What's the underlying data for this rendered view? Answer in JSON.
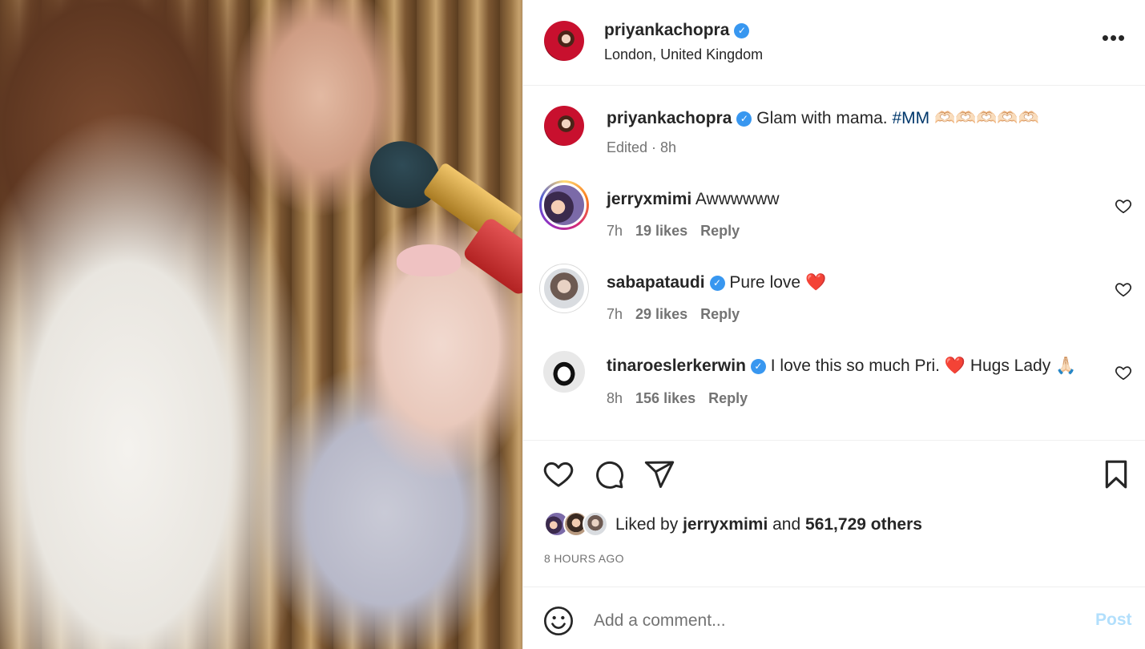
{
  "post": {
    "photo_alt": "photo-mother-baby-makeup-brush"
  },
  "header": {
    "username": "priyankachopra",
    "verified_icon": "verified-badge-icon",
    "location": "London, United Kingdom",
    "more_label": "•••"
  },
  "caption": {
    "username": "priyankachopra",
    "text": " Glam with mama. ",
    "hashtag": "#MM",
    "emoji_tail": " 🫶🏻🫶🏻🫶🏻🫶🏻🫶🏻",
    "edited": "Edited",
    "sep": " · ",
    "time": "8h"
  },
  "comments": [
    {
      "username": "jerryxmimi",
      "verified": false,
      "text": " Awwwwww",
      "time": "7h",
      "likes": "19 likes",
      "reply": "Reply"
    },
    {
      "username": "sabapataudi",
      "verified": true,
      "text": " Pure love ",
      "emoji": "❤️",
      "time": "7h",
      "likes": "29 likes",
      "reply": "Reply"
    },
    {
      "username": "tinaroeslerkerwin",
      "verified": true,
      "text": " I love this so much Pri. ",
      "emoji": "❤️",
      "text2": " Hugs Lady ",
      "emoji2": "🙏🏻",
      "time": "8h",
      "likes": "156 likes",
      "reply": "Reply"
    }
  ],
  "actions": {
    "liked_prefix": "Liked by ",
    "liked_user": "jerryxmimi",
    "liked_mid": " and ",
    "liked_others": "561,729 others",
    "timeago": "8 HOURS AGO"
  },
  "add_comment": {
    "placeholder": "Add a comment...",
    "post_label": "Post"
  },
  "colors": {
    "verified": "#3897f0",
    "hashtag": "#00376b",
    "muted": "#737373",
    "post_disabled": "#b2dffc",
    "heart_red": "#ed4956"
  }
}
